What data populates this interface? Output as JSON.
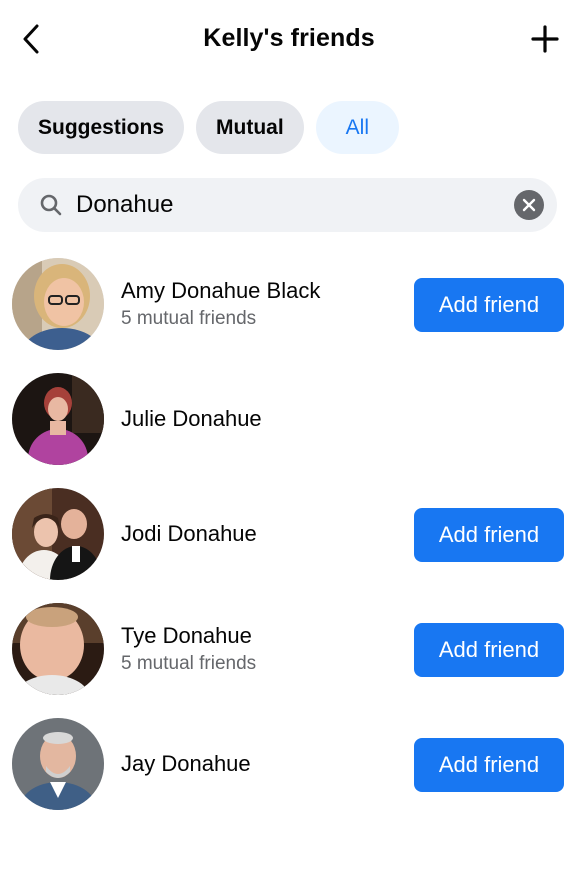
{
  "header": {
    "title": "Kelly's friends",
    "back_icon": "chevron-left-icon",
    "add_icon": "plus-icon"
  },
  "tabs": [
    {
      "label": "Suggestions",
      "active": false
    },
    {
      "label": "Mutual",
      "active": false
    },
    {
      "label": "All",
      "active": true
    }
  ],
  "search": {
    "value": "Donahue",
    "icon": "search-icon",
    "clear_icon": "clear-icon"
  },
  "friends": [
    {
      "name": "Amy Donahue Black",
      "mutual": "5 mutual friends",
      "button": "Add friend"
    },
    {
      "name": "Julie Donahue",
      "mutual": "",
      "button": ""
    },
    {
      "name": "Jodi Donahue",
      "mutual": "",
      "button": "Add friend"
    },
    {
      "name": "Tye Donahue",
      "mutual": "5 mutual friends",
      "button": "Add friend"
    },
    {
      "name": "Jay Donahue",
      "mutual": "",
      "button": "Add friend"
    }
  ],
  "colors": {
    "accent": "#1877f2",
    "active_tab_bg": "#ebf5ff",
    "tab_bg": "#e4e6eb",
    "search_bg": "#f0f2f5",
    "secondary_text": "#65676b"
  }
}
